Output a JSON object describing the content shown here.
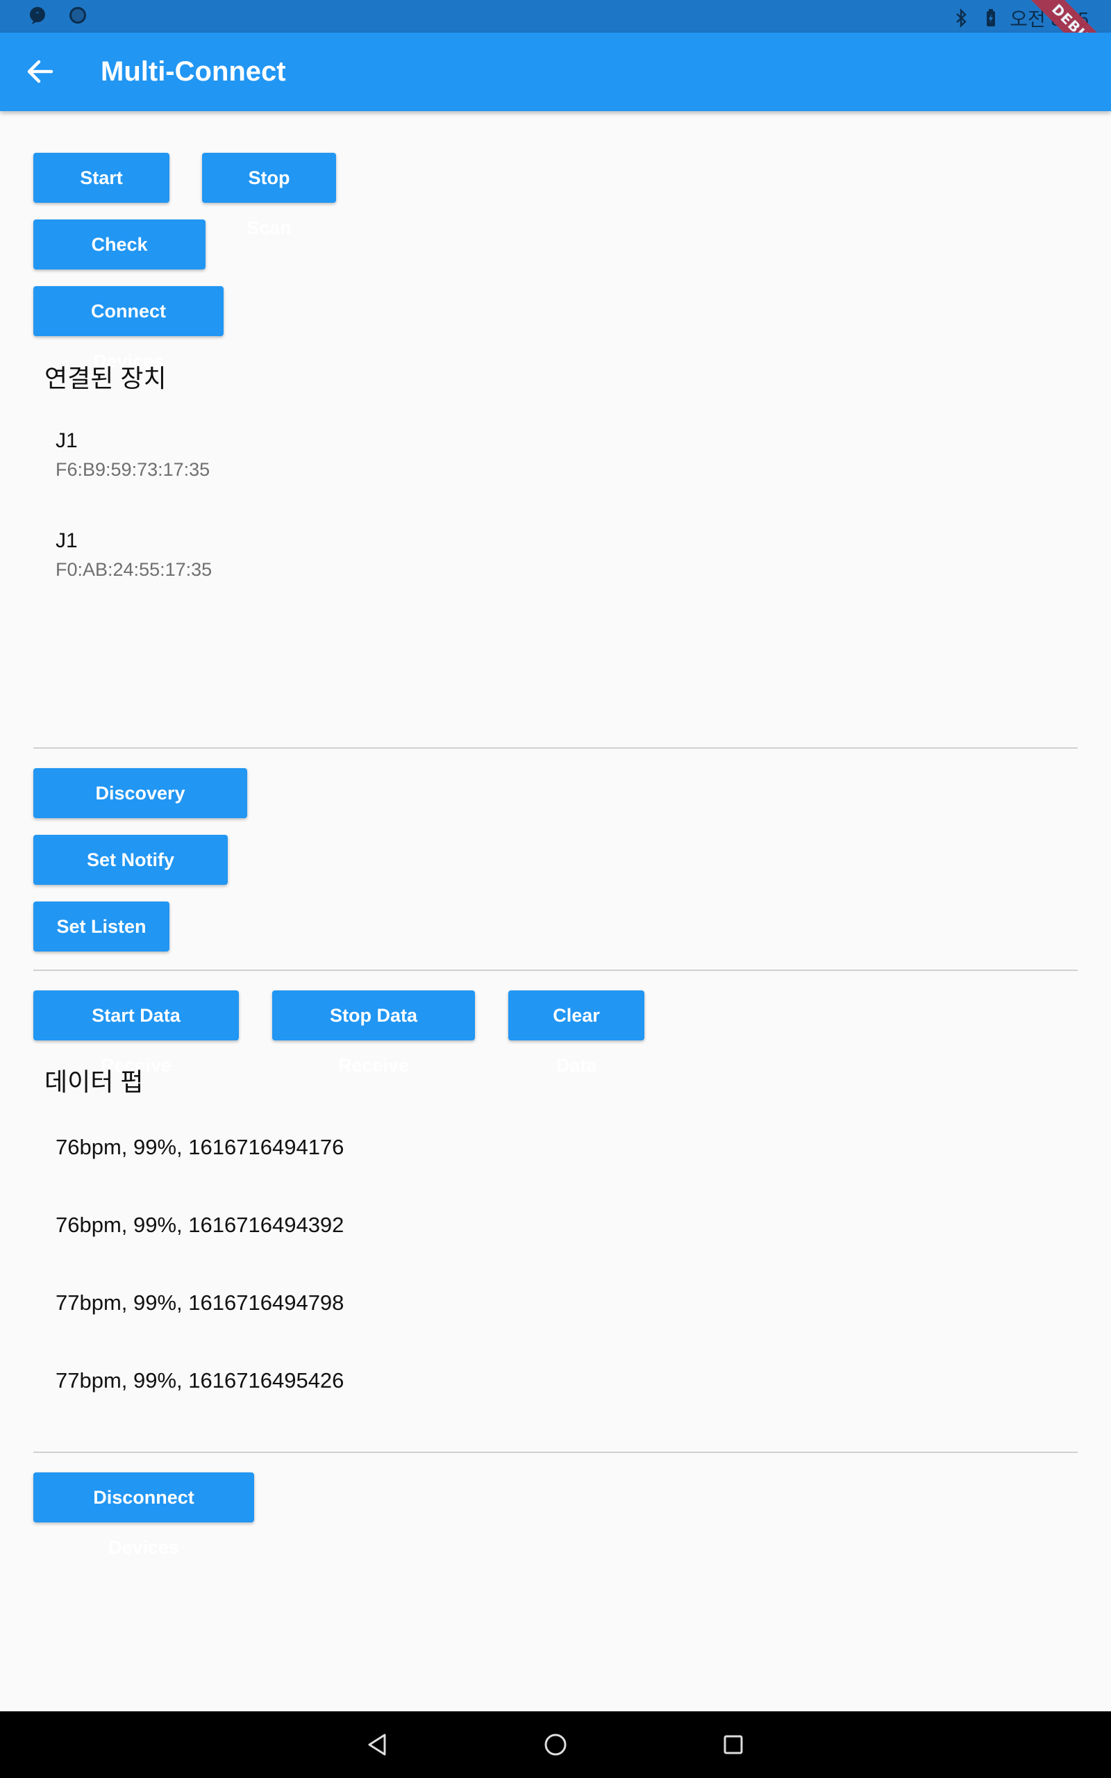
{
  "status_bar": {
    "time": "오전 8:55",
    "debug_label": "DEBUG",
    "icons": [
      "chat-notification-icon",
      "circle-app-icon",
      "bluetooth-icon",
      "battery-icon"
    ]
  },
  "app_bar": {
    "title": "Multi-Connect",
    "back_icon": "back-arrow-icon"
  },
  "scan": {
    "start_label": "Start Scan",
    "stop_label": "Stop Scan",
    "check_label": "Check Devices",
    "connect_label": "Connect Devices"
  },
  "connected": {
    "heading": "연결된 장치",
    "devices": [
      {
        "name": "J1",
        "mac": "F6:B9:59:73:17:35"
      },
      {
        "name": "J1",
        "mac": "F0:AB:24:55:17:35"
      }
    ]
  },
  "services": {
    "discovery_label": "Discovery Services",
    "notify_label": "Set Notify Enable",
    "listen_label": "Set Listen"
  },
  "data": {
    "start_label": "Start Data Receive",
    "stop_label": "Stop Data Receive",
    "clear_label": "Clear Data",
    "heading": "데이터 펍",
    "rows": [
      "76bpm, 99%, 1616716494176",
      "76bpm, 99%, 1616716494392",
      "77bpm, 99%, 1616716494798",
      "77bpm, 99%, 1616716495426"
    ]
  },
  "footer": {
    "disconnect_label": "Disconnect Devices"
  },
  "colors": {
    "primary": "#2196f3",
    "status_bar": "#1e77c6",
    "background": "#fafafa"
  }
}
